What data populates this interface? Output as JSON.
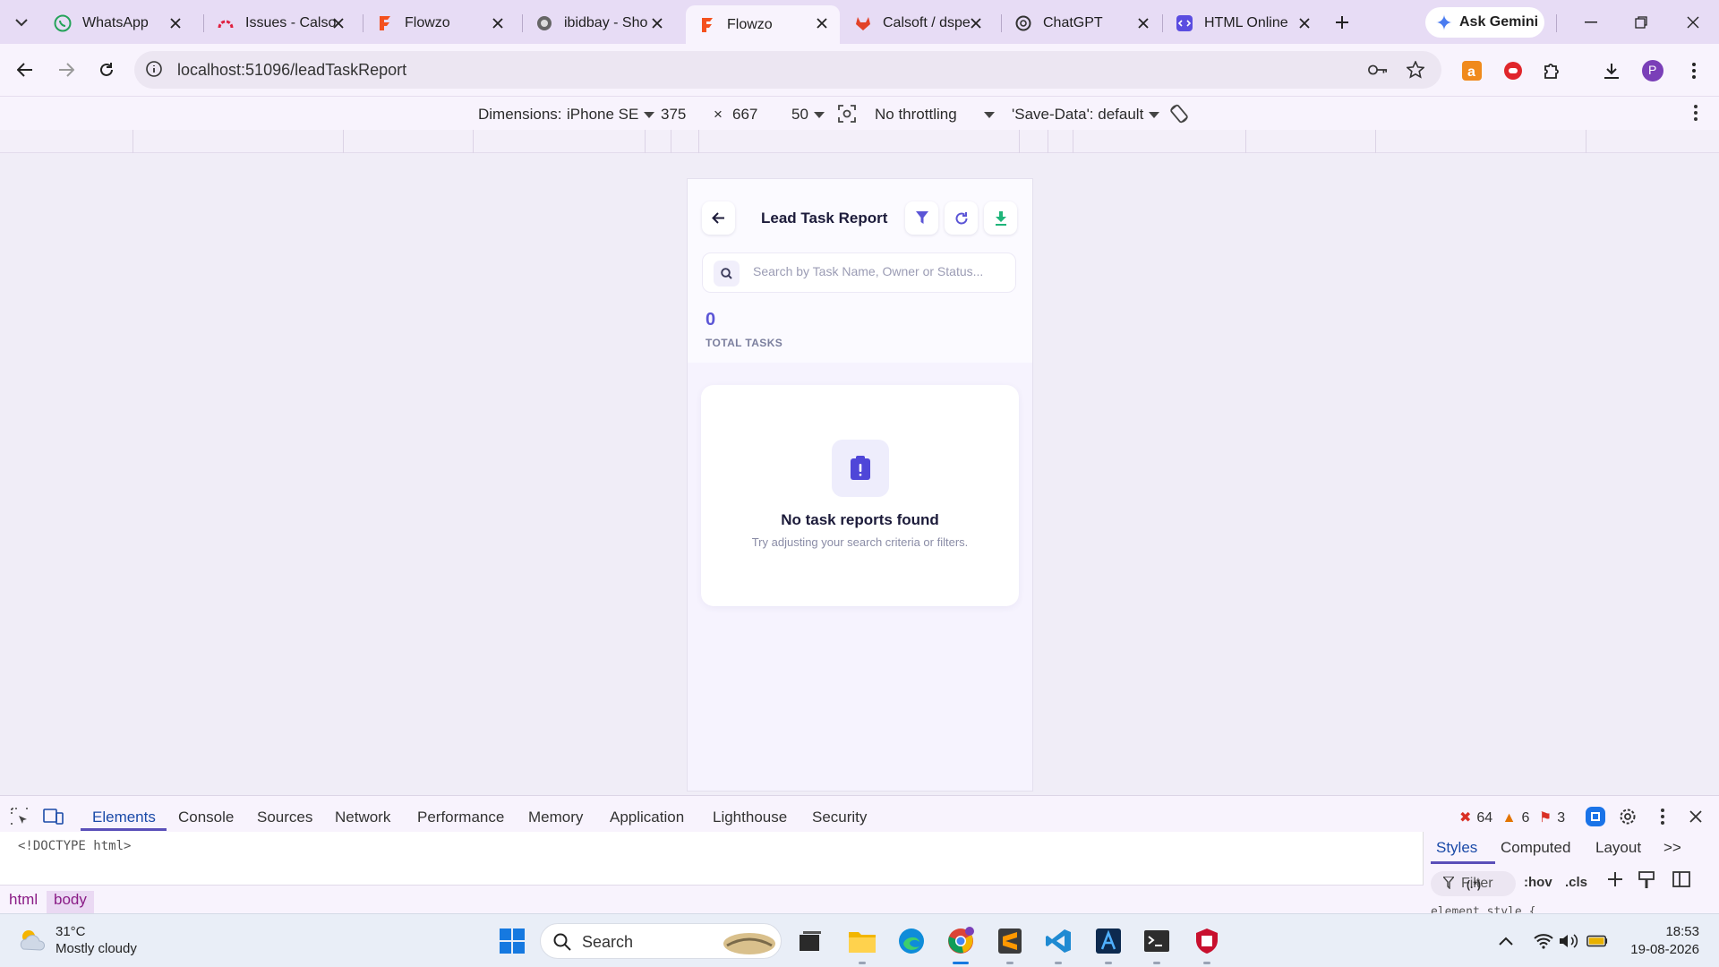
{
  "browser": {
    "tabs": [
      {
        "title": "WhatsApp",
        "icon": "whatsapp-icon"
      },
      {
        "title": "Issues - Calso",
        "icon": "issues-icon"
      },
      {
        "title": "Flowzo",
        "icon": "flowzo-icon"
      },
      {
        "title": "ibidbay - Sho",
        "icon": "globe-icon"
      },
      {
        "title": "Flowzo",
        "icon": "flowzo-icon",
        "active": true
      },
      {
        "title": "Calsoft / dspe",
        "icon": "gitlab-icon"
      },
      {
        "title": "ChatGPT",
        "icon": "chatgpt-icon"
      },
      {
        "title": "HTML Online",
        "icon": "html-icon"
      }
    ],
    "ask_gemini": "Ask Gemini",
    "url": "localhost:51096/leadTaskReport",
    "profile_initial": "P"
  },
  "device_toolbar": {
    "dimensions_label": "Dimensions:",
    "device": "iPhone SE",
    "width": "375",
    "times": "×",
    "height": "667",
    "zoom": "50",
    "throttling": "No throttling",
    "save_data": "'Save-Data': default"
  },
  "app": {
    "title": "Lead Task Report",
    "search_placeholder": "Search by Task Name, Owner or Status...",
    "total_count": "0",
    "total_label": "TOTAL TASKS",
    "empty_title": "No task reports found",
    "empty_subtitle": "Try adjusting your search criteria or filters.",
    "accent": "#5b55d6",
    "download_color": "#1fb57a"
  },
  "devtools": {
    "tabs": [
      "Elements",
      "Console",
      "Sources",
      "Network",
      "Performance",
      "Memory",
      "Application",
      "Lighthouse",
      "Security"
    ],
    "errors": "64",
    "warnings": "6",
    "issues": "3",
    "doctype": "<!DOCTYPE html>",
    "breadcrumbs": [
      "html",
      "body"
    ],
    "styles_tabs": [
      "Styles",
      "Computed",
      "Layout"
    ],
    "more": ">>",
    "filter_placeholder": "Filter",
    "regex_toggle": "(.*)",
    "hov": ":hov",
    "cls": ".cls",
    "element_style": "element.style {"
  },
  "taskbar": {
    "temperature": "31°C",
    "weather": "Mostly cloudy",
    "search_label": "Search",
    "time": "18:53",
    "date": "19-08-2026"
  }
}
